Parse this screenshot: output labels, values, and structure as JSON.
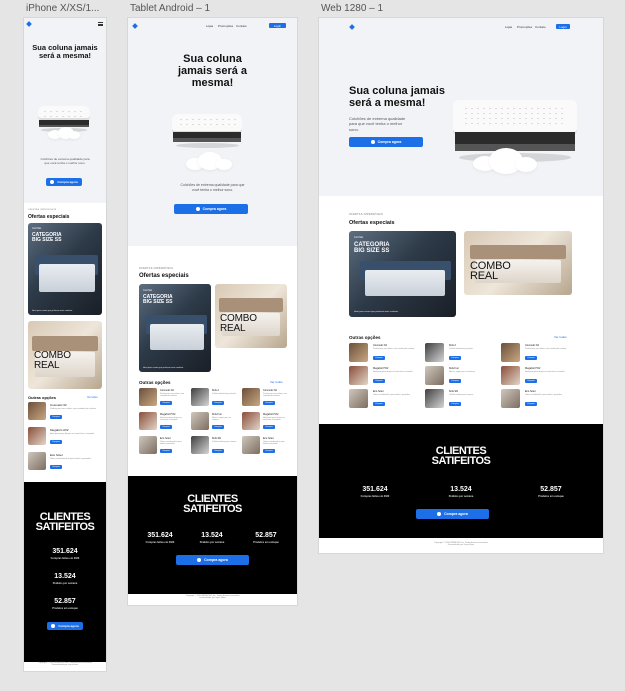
{
  "artboards": {
    "phone": "iPhone X/XS/1...",
    "tablet": "Tablet Android – 1",
    "web": "Web 1280 – 1"
  },
  "nav": {
    "links": [
      "Lojas",
      "Promoções",
      "Contato"
    ],
    "login": "Login"
  },
  "hero": {
    "title": "Sua coluna jamais será a mesma!",
    "title_lines": [
      "Sua coluna jamais",
      "será a mesma!"
    ],
    "title_lines_tablet": [
      "Sua coluna",
      "jamais será a",
      "mesma!"
    ],
    "description": "Colchões de extrema qualidade para que você tenha o melhor sono.",
    "cta": "Compra agora"
  },
  "offers": {
    "eyebrow": "OFERTAS IMPERDÍVEIS",
    "title": "Ofertas especiais",
    "card1": {
      "tag": "Colchão",
      "title_l1": "CATEGORIA",
      "title_l2": "BIG SIZE SS",
      "caption": "Ideal para casais que preferem mais conforto."
    },
    "card2": {
      "l1": "COMBO",
      "l2": "REAL"
    }
  },
  "options": {
    "title": "Outras opções",
    "see_more": "Ver todos",
    "button": "Comprar",
    "products": [
      {
        "name": "Cosmetic 62",
        "desc": "Perfeito para sua coluna, com camadas de conforto."
      },
      {
        "name": "Megafort HX2",
        "desc": "Ideal para quem deseja um sono firme e tranquilo."
      },
      {
        "name": "Eco hotel",
        "desc": "Ótimo custo-benefício para hotéis e pousadas."
      },
      {
        "name": "Kids 2",
        "desc": "Colchão infantil com proteção."
      },
      {
        "name": "Kids Fun",
        "desc": "Macio e seguro para as crianças."
      },
      {
        "name": "Kids SD",
        "desc": "Colchão solteiro para crianças."
      },
      {
        "name": "Cosmetic 62",
        "desc": "Perfeito para sua coluna, com camadas de conforto."
      },
      {
        "name": "Megafort HX2",
        "desc": "Ideal para quem deseja um sono firme e tranquilo."
      },
      {
        "name": "Eco hotel",
        "desc": "Ótimo custo-benefício para hotéis e pousadas."
      }
    ]
  },
  "clients": {
    "title_l1": "CLIENTES",
    "title_l2": "SATIFEITOS",
    "stats": [
      {
        "value": "351.624",
        "label": "Compras feitas em 2020"
      },
      {
        "value": "13.524",
        "label": "Pedidos por semana"
      },
      {
        "value": "52.857",
        "label": "Produtos em estoque"
      }
    ],
    "cta": "Compra agora"
  },
  "footer": {
    "line1": "Copyright © 2020 WRBSONO Inc. Todos direitos reservados",
    "line2": "Desenvolvido por Joyce Hime"
  },
  "colors": {
    "accent": "#1d6fe8",
    "dark": "#000000",
    "hero_bg": "#f2f3f6"
  }
}
